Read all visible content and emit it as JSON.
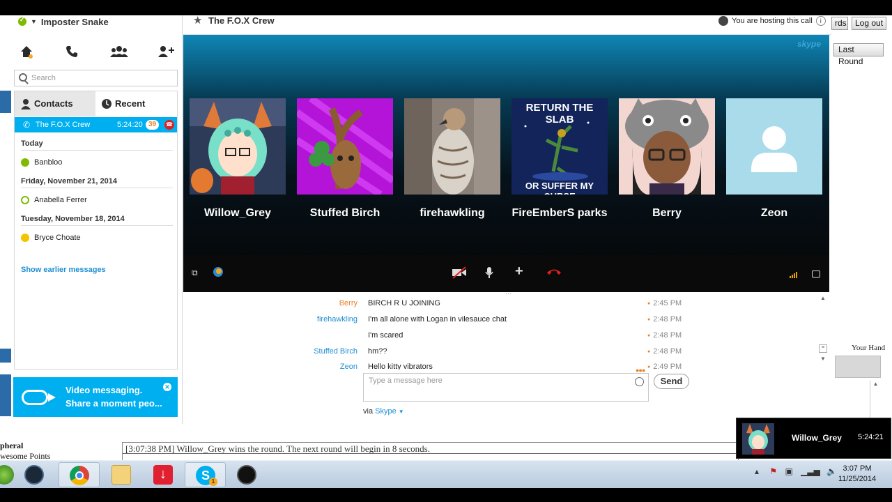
{
  "background_app": {
    "buttons": {
      "cards_fragment": "rds",
      "logout": "Log out",
      "last_round": "Last Round"
    },
    "left_labels": {
      "line1": "pheral",
      "line2": "wesome Points"
    },
    "log_text": "[3:07:38 PM] Willow_Grey wins the round. The next round will begin in 8 seconds.",
    "your_hand": "Your Hand"
  },
  "skype": {
    "user": {
      "name": "Imposter Snake"
    },
    "search": {
      "placeholder": "Search"
    },
    "tabs": [
      {
        "label": "Contacts"
      },
      {
        "label": "Recent"
      }
    ],
    "active_call": {
      "name": "The F.O.X Crew",
      "duration": "5:24:20",
      "unread": "39"
    },
    "recent": [
      {
        "date": "Today",
        "contacts": [
          {
            "name": "Banbloo",
            "status_color": "#7fba00"
          }
        ]
      },
      {
        "date": "Friday, November 21, 2014",
        "contacts": [
          {
            "name": "Anabella Ferrer",
            "status_color": "#7fba00"
          }
        ]
      },
      {
        "date": "Tuesday, November 18, 2014",
        "contacts": [
          {
            "name": "Bryce Choate",
            "status_color": "#f5c400"
          }
        ]
      }
    ],
    "show_earlier": "Show earlier messages",
    "promo": {
      "title": "Video messaging.",
      "subtitle": "Share a moment peo..."
    },
    "conversation": {
      "title": "The F.O.X Crew",
      "hosting_text": "You are hosting this call",
      "logo": "skype",
      "participants": [
        {
          "name": "Willow_Grey"
        },
        {
          "name": "Stuffed Birch"
        },
        {
          "name": "firehawkling"
        },
        {
          "name": "FireEmberSparks",
          "display": "FireEmberS parks",
          "avatar_text_top": "RETURN THE SLAB",
          "avatar_text_bottom": "OR SUFFER MY CURSE"
        },
        {
          "name": "Berry"
        },
        {
          "name": "Zeon"
        }
      ],
      "messages": [
        {
          "sender": "Berry",
          "sender_color": "#e8812c",
          "text": "BIRCH R U JOINING",
          "time": "2:45 PM"
        },
        {
          "sender": "firehawkling",
          "sender_color": "#1e8fd2",
          "text": "I'm all alone with Logan in vilesauce chat",
          "time": "2:48 PM"
        },
        {
          "sender": "",
          "sender_color": "#1e8fd2",
          "text": "I'm scared",
          "time": "2:48 PM"
        },
        {
          "sender": "Stuffed Birch",
          "sender_color": "#1e8fd2",
          "text": "hm??",
          "time": "2:48 PM"
        },
        {
          "sender": "Zeon",
          "sender_color": "#1e8fd2",
          "text": "Hello kitty vibrators",
          "time": "2:49 PM"
        }
      ],
      "compose_placeholder": "Type a message here",
      "send_label": "Send",
      "via_label": "via",
      "via_service": "Skype"
    },
    "toast": {
      "name": "Willow_Grey",
      "duration": "5:24:21"
    }
  },
  "taskbar": {
    "apps": [
      "start-orb",
      "steam",
      "chrome",
      "file-explorer",
      "downloader",
      "skype",
      "obs"
    ],
    "skype_badge": "1",
    "clock": {
      "time": "3:07 PM",
      "date": "11/25/2014"
    }
  },
  "colors": {
    "skype_blue": "#00aff0",
    "hangup_red": "#e02020",
    "accent_orange": "#e8812c"
  }
}
